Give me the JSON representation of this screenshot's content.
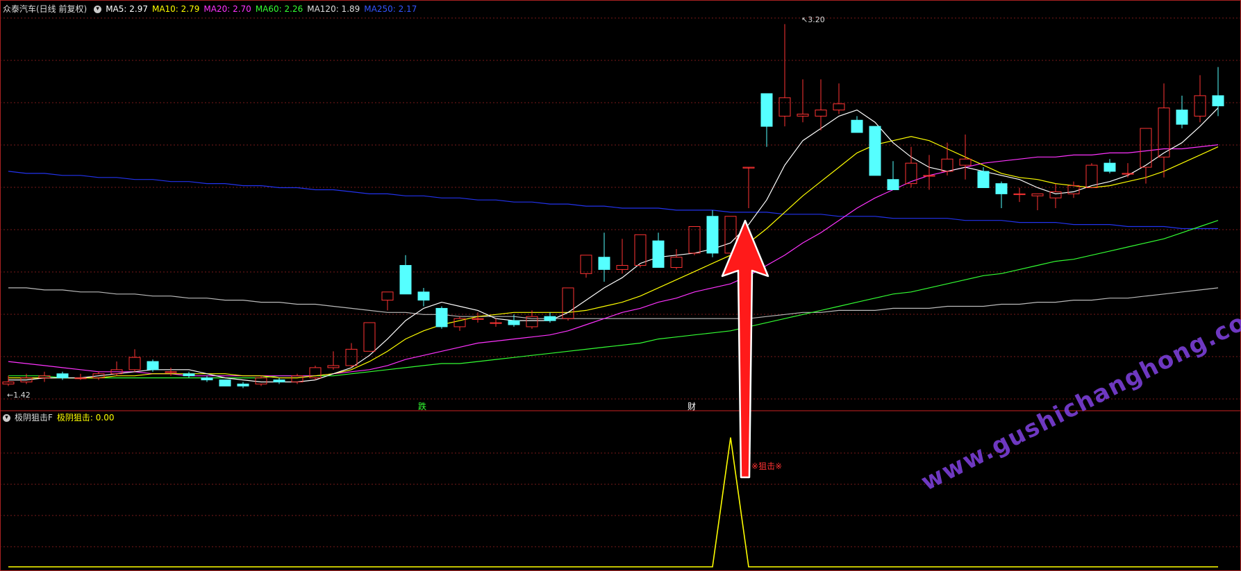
{
  "header": {
    "stock_name": "众泰汽车(日线 前复权)",
    "ma_labels": [
      {
        "text": "MA5: 2.97",
        "color": "#ffffff"
      },
      {
        "text": "MA10: 2.79",
        "color": "#ffff00"
      },
      {
        "text": "MA20: 2.70",
        "color": "#ff33ff"
      },
      {
        "text": "MA60: 2.26",
        "color": "#33ff33"
      },
      {
        "text": "MA120: 1.89",
        "color": "#dddddd"
      },
      {
        "text": "MA250: 2.17",
        "color": "#3355ff"
      }
    ]
  },
  "indicator": {
    "name": "极阴狙击F",
    "value_label": "极阴狙击: 0.00",
    "signal_text": "狙击"
  },
  "annotations": {
    "max_price": "3.20",
    "min_price": "1.42",
    "marker_1": "跌",
    "marker_2": "财"
  },
  "watermark": "www.gushichanghong.com",
  "colors": {
    "up": "#ff3333",
    "down": "#55ffff",
    "grid": "#7a1a1a",
    "arrow": "#ff1a1a"
  },
  "chart_data": {
    "type": "candlestick",
    "ylim": [
      1.35,
      3.25
    ],
    "candles": [
      [
        1.44,
        1.45,
        1.43,
        1.48
      ],
      [
        1.45,
        1.47,
        1.44,
        1.49
      ],
      [
        1.47,
        1.48,
        1.45,
        1.5
      ],
      [
        1.49,
        1.47,
        1.46,
        1.5
      ],
      [
        1.47,
        1.47,
        1.46,
        1.49
      ],
      [
        1.47,
        1.49,
        1.46,
        1.5
      ],
      [
        1.49,
        1.51,
        1.48,
        1.55
      ],
      [
        1.51,
        1.57,
        1.5,
        1.61
      ],
      [
        1.55,
        1.51,
        1.5,
        1.56
      ],
      [
        1.5,
        1.5,
        1.48,
        1.52
      ],
      [
        1.49,
        1.48,
        1.47,
        1.5
      ],
      [
        1.47,
        1.46,
        1.45,
        1.48
      ],
      [
        1.46,
        1.43,
        1.43,
        1.46
      ],
      [
        1.44,
        1.43,
        1.42,
        1.45
      ],
      [
        1.44,
        1.47,
        1.43,
        1.48
      ],
      [
        1.46,
        1.45,
        1.44,
        1.47
      ],
      [
        1.45,
        1.48,
        1.44,
        1.49
      ],
      [
        1.47,
        1.52,
        1.46,
        1.53
      ],
      [
        1.52,
        1.53,
        1.51,
        1.6
      ],
      [
        1.53,
        1.61,
        1.52,
        1.64
      ],
      [
        1.6,
        1.74,
        1.6,
        1.74
      ],
      [
        1.85,
        1.89,
        1.8,
        1.89
      ],
      [
        2.02,
        1.88,
        1.88,
        2.07
      ],
      [
        1.89,
        1.85,
        1.82,
        1.91
      ],
      [
        1.81,
        1.72,
        1.71,
        1.82
      ],
      [
        1.72,
        1.76,
        1.7,
        1.77
      ],
      [
        1.76,
        1.76,
        1.74,
        1.79
      ],
      [
        1.74,
        1.74,
        1.72,
        1.76
      ],
      [
        1.75,
        1.73,
        1.72,
        1.78
      ],
      [
        1.72,
        1.77,
        1.71,
        1.8
      ],
      [
        1.77,
        1.75,
        1.74,
        1.79
      ],
      [
        1.76,
        1.91,
        1.75,
        1.91
      ],
      [
        1.98,
        2.07,
        1.96,
        2.07
      ],
      [
        2.06,
        2.0,
        1.94,
        2.18
      ],
      [
        2.0,
        2.02,
        1.98,
        2.15
      ],
      [
        2.02,
        2.17,
        2.01,
        2.17
      ],
      [
        2.14,
        2.01,
        2.01,
        2.18
      ],
      [
        2.01,
        2.06,
        2.0,
        2.1
      ],
      [
        2.08,
        2.21,
        2.07,
        2.21
      ],
      [
        2.26,
        2.08,
        2.06,
        2.29
      ],
      [
        2.08,
        2.26,
        2.07,
        2.26
      ],
      [
        2.5,
        2.5,
        2.3,
        2.5
      ],
      [
        2.86,
        2.7,
        2.6,
        2.86
      ],
      [
        2.75,
        2.84,
        2.7,
        3.2
      ],
      [
        2.75,
        2.76,
        2.72,
        2.93
      ],
      [
        2.75,
        2.78,
        2.68,
        2.93
      ],
      [
        2.78,
        2.81,
        2.76,
        2.91
      ],
      [
        2.73,
        2.67,
        2.67,
        2.75
      ],
      [
        2.7,
        2.46,
        2.46,
        2.7
      ],
      [
        2.44,
        2.39,
        2.39,
        2.53
      ],
      [
        2.42,
        2.52,
        2.4,
        2.6
      ],
      [
        2.46,
        2.46,
        2.39,
        2.56
      ],
      [
        2.48,
        2.54,
        2.46,
        2.62
      ],
      [
        2.51,
        2.54,
        2.44,
        2.66
      ],
      [
        2.48,
        2.4,
        2.4,
        2.5
      ],
      [
        2.42,
        2.37,
        2.3,
        2.43
      ],
      [
        2.37,
        2.37,
        2.33,
        2.4
      ],
      [
        2.36,
        2.37,
        2.29,
        2.37
      ],
      [
        2.35,
        2.38,
        2.3,
        2.42
      ],
      [
        2.37,
        2.41,
        2.35,
        2.43
      ],
      [
        2.4,
        2.51,
        2.4,
        2.52
      ],
      [
        2.52,
        2.48,
        2.47,
        2.54
      ],
      [
        2.47,
        2.47,
        2.45,
        2.52
      ],
      [
        2.5,
        2.69,
        2.42,
        2.69
      ],
      [
        2.55,
        2.79,
        2.45,
        2.91
      ],
      [
        2.78,
        2.71,
        2.69,
        2.85
      ],
      [
        2.75,
        2.85,
        2.72,
        2.95
      ],
      [
        2.85,
        2.8,
        2.75,
        2.99
      ]
    ],
    "ma": [
      {
        "name": "MA5",
        "color": "#ffffff",
        "values": [
          1.46,
          1.46,
          1.47,
          1.47,
          1.47,
          1.48,
          1.49,
          1.5,
          1.51,
          1.51,
          1.51,
          1.49,
          1.47,
          1.46,
          1.45,
          1.45,
          1.45,
          1.46,
          1.49,
          1.52,
          1.58,
          1.66,
          1.75,
          1.81,
          1.84,
          1.82,
          1.8,
          1.76,
          1.75,
          1.75,
          1.75,
          1.79,
          1.85,
          1.91,
          1.96,
          2.03,
          2.06,
          2.07,
          2.08,
          2.1,
          2.13,
          2.22,
          2.34,
          2.51,
          2.63,
          2.69,
          2.75,
          2.78,
          2.72,
          2.62,
          2.55,
          2.5,
          2.48,
          2.5,
          2.48,
          2.46,
          2.44,
          2.4,
          2.37,
          2.38,
          2.41,
          2.43,
          2.46,
          2.51,
          2.57,
          2.62,
          2.7,
          2.79
        ]
      },
      {
        "name": "MA10",
        "color": "#ffff00",
        "values": [
          1.47,
          1.47,
          1.47,
          1.47,
          1.47,
          1.47,
          1.48,
          1.48,
          1.49,
          1.49,
          1.49,
          1.49,
          1.49,
          1.48,
          1.48,
          1.47,
          1.47,
          1.48,
          1.49,
          1.51,
          1.55,
          1.6,
          1.66,
          1.7,
          1.73,
          1.75,
          1.77,
          1.78,
          1.79,
          1.79,
          1.79,
          1.79,
          1.8,
          1.82,
          1.84,
          1.87,
          1.91,
          1.95,
          1.99,
          2.03,
          2.07,
          2.13,
          2.2,
          2.28,
          2.36,
          2.43,
          2.5,
          2.57,
          2.61,
          2.63,
          2.65,
          2.63,
          2.59,
          2.55,
          2.51,
          2.47,
          2.45,
          2.44,
          2.42,
          2.41,
          2.4,
          2.41,
          2.43,
          2.45,
          2.48,
          2.52,
          2.56,
          2.6
        ]
      },
      {
        "name": "MA20",
        "color": "#ff33ff",
        "values": [
          1.55,
          1.54,
          1.53,
          1.52,
          1.51,
          1.5,
          1.5,
          1.5,
          1.49,
          1.49,
          1.48,
          1.48,
          1.48,
          1.48,
          1.48,
          1.48,
          1.48,
          1.48,
          1.49,
          1.5,
          1.51,
          1.53,
          1.56,
          1.58,
          1.6,
          1.62,
          1.64,
          1.65,
          1.66,
          1.67,
          1.68,
          1.7,
          1.73,
          1.76,
          1.79,
          1.81,
          1.84,
          1.86,
          1.89,
          1.91,
          1.93,
          1.97,
          2.02,
          2.07,
          2.13,
          2.18,
          2.24,
          2.3,
          2.35,
          2.39,
          2.43,
          2.46,
          2.48,
          2.5,
          2.52,
          2.53,
          2.54,
          2.55,
          2.55,
          2.56,
          2.56,
          2.57,
          2.57,
          2.58,
          2.59,
          2.59,
          2.6,
          2.61
        ]
      },
      {
        "name": "MA60",
        "color": "#33ff33",
        "values": [
          1.48,
          1.48,
          1.48,
          1.47,
          1.47,
          1.47,
          1.47,
          1.47,
          1.47,
          1.47,
          1.47,
          1.47,
          1.47,
          1.47,
          1.47,
          1.48,
          1.48,
          1.48,
          1.48,
          1.49,
          1.5,
          1.51,
          1.52,
          1.53,
          1.54,
          1.54,
          1.55,
          1.56,
          1.57,
          1.58,
          1.59,
          1.6,
          1.61,
          1.62,
          1.63,
          1.64,
          1.66,
          1.67,
          1.68,
          1.69,
          1.7,
          1.72,
          1.74,
          1.76,
          1.78,
          1.8,
          1.82,
          1.84,
          1.86,
          1.88,
          1.89,
          1.91,
          1.93,
          1.95,
          1.97,
          1.98,
          2.0,
          2.02,
          2.04,
          2.05,
          2.07,
          2.09,
          2.11,
          2.13,
          2.15,
          2.18,
          2.21,
          2.24
        ]
      },
      {
        "name": "MA120",
        "color": "#bbbbbb",
        "values": [
          1.91,
          1.91,
          1.9,
          1.9,
          1.89,
          1.89,
          1.88,
          1.88,
          1.87,
          1.87,
          1.86,
          1.86,
          1.85,
          1.85,
          1.84,
          1.84,
          1.83,
          1.83,
          1.82,
          1.81,
          1.8,
          1.79,
          1.79,
          1.78,
          1.78,
          1.77,
          1.77,
          1.77,
          1.77,
          1.76,
          1.76,
          1.76,
          1.76,
          1.76,
          1.76,
          1.76,
          1.76,
          1.76,
          1.76,
          1.76,
          1.76,
          1.76,
          1.77,
          1.78,
          1.79,
          1.79,
          1.8,
          1.8,
          1.8,
          1.81,
          1.81,
          1.81,
          1.82,
          1.82,
          1.82,
          1.83,
          1.83,
          1.84,
          1.84,
          1.85,
          1.85,
          1.86,
          1.86,
          1.87,
          1.88,
          1.89,
          1.9,
          1.91
        ]
      },
      {
        "name": "MA250",
        "color": "#2233ee",
        "values": [
          2.48,
          2.47,
          2.47,
          2.46,
          2.46,
          2.45,
          2.45,
          2.44,
          2.44,
          2.43,
          2.43,
          2.42,
          2.42,
          2.41,
          2.41,
          2.4,
          2.4,
          2.39,
          2.39,
          2.38,
          2.37,
          2.37,
          2.36,
          2.36,
          2.35,
          2.35,
          2.34,
          2.34,
          2.33,
          2.33,
          2.32,
          2.32,
          2.31,
          2.31,
          2.3,
          2.3,
          2.3,
          2.29,
          2.29,
          2.29,
          2.28,
          2.28,
          2.28,
          2.27,
          2.27,
          2.27,
          2.26,
          2.26,
          2.26,
          2.25,
          2.25,
          2.25,
          2.25,
          2.24,
          2.24,
          2.24,
          2.23,
          2.23,
          2.23,
          2.22,
          2.22,
          2.22,
          2.21,
          2.21,
          2.21,
          2.2,
          2.2,
          2.2
        ]
      }
    ],
    "indicator_series": {
      "name": "极阴狙击",
      "color": "#ffff00",
      "ylim": [
        0,
        1.1
      ],
      "values": [
        0,
        0,
        0,
        0,
        0,
        0,
        0,
        0,
        0,
        0,
        0,
        0,
        0,
        0,
        0,
        0,
        0,
        0,
        0,
        0,
        0,
        0,
        0,
        0,
        0,
        0,
        0,
        0,
        0,
        0,
        0,
        0,
        0,
        0,
        0,
        0,
        0,
        0,
        0,
        0,
        1,
        0,
        0,
        0,
        0,
        0,
        0,
        0,
        0,
        0,
        0,
        0,
        0,
        0,
        0,
        0,
        0,
        0,
        0,
        0,
        0,
        0,
        0,
        0,
        0,
        0,
        0,
        0
      ]
    }
  }
}
